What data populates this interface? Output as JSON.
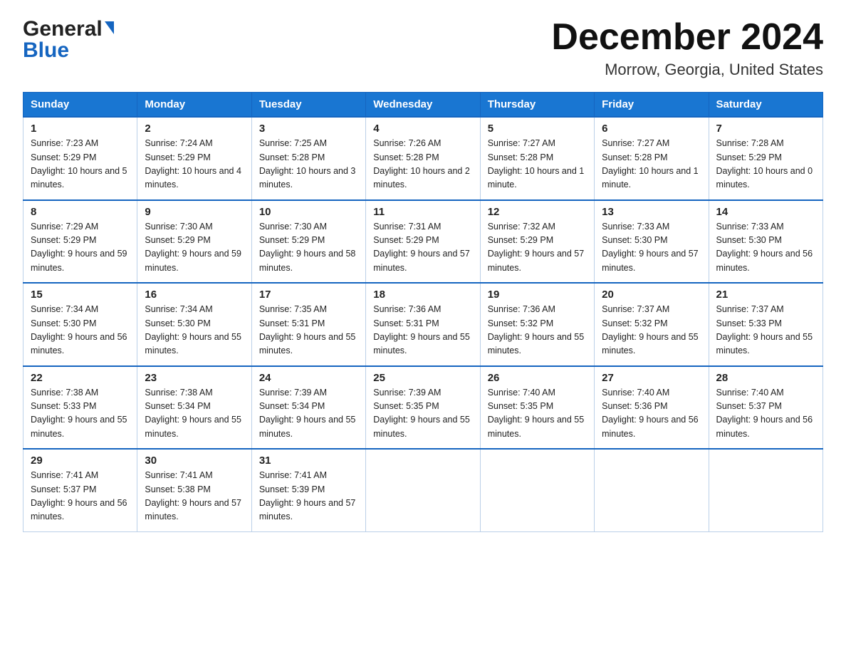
{
  "header": {
    "logo_general": "General",
    "logo_blue": "Blue",
    "month_title": "December 2024",
    "location": "Morrow, Georgia, United States"
  },
  "weekdays": [
    "Sunday",
    "Monday",
    "Tuesday",
    "Wednesday",
    "Thursday",
    "Friday",
    "Saturday"
  ],
  "weeks": [
    [
      {
        "day": "1",
        "sunrise": "7:23 AM",
        "sunset": "5:29 PM",
        "daylight": "10 hours and 5 minutes."
      },
      {
        "day": "2",
        "sunrise": "7:24 AM",
        "sunset": "5:29 PM",
        "daylight": "10 hours and 4 minutes."
      },
      {
        "day": "3",
        "sunrise": "7:25 AM",
        "sunset": "5:28 PM",
        "daylight": "10 hours and 3 minutes."
      },
      {
        "day": "4",
        "sunrise": "7:26 AM",
        "sunset": "5:28 PM",
        "daylight": "10 hours and 2 minutes."
      },
      {
        "day": "5",
        "sunrise": "7:27 AM",
        "sunset": "5:28 PM",
        "daylight": "10 hours and 1 minute."
      },
      {
        "day": "6",
        "sunrise": "7:27 AM",
        "sunset": "5:28 PM",
        "daylight": "10 hours and 1 minute."
      },
      {
        "day": "7",
        "sunrise": "7:28 AM",
        "sunset": "5:29 PM",
        "daylight": "10 hours and 0 minutes."
      }
    ],
    [
      {
        "day": "8",
        "sunrise": "7:29 AM",
        "sunset": "5:29 PM",
        "daylight": "9 hours and 59 minutes."
      },
      {
        "day": "9",
        "sunrise": "7:30 AM",
        "sunset": "5:29 PM",
        "daylight": "9 hours and 59 minutes."
      },
      {
        "day": "10",
        "sunrise": "7:30 AM",
        "sunset": "5:29 PM",
        "daylight": "9 hours and 58 minutes."
      },
      {
        "day": "11",
        "sunrise": "7:31 AM",
        "sunset": "5:29 PM",
        "daylight": "9 hours and 57 minutes."
      },
      {
        "day": "12",
        "sunrise": "7:32 AM",
        "sunset": "5:29 PM",
        "daylight": "9 hours and 57 minutes."
      },
      {
        "day": "13",
        "sunrise": "7:33 AM",
        "sunset": "5:30 PM",
        "daylight": "9 hours and 57 minutes."
      },
      {
        "day": "14",
        "sunrise": "7:33 AM",
        "sunset": "5:30 PM",
        "daylight": "9 hours and 56 minutes."
      }
    ],
    [
      {
        "day": "15",
        "sunrise": "7:34 AM",
        "sunset": "5:30 PM",
        "daylight": "9 hours and 56 minutes."
      },
      {
        "day": "16",
        "sunrise": "7:34 AM",
        "sunset": "5:30 PM",
        "daylight": "9 hours and 55 minutes."
      },
      {
        "day": "17",
        "sunrise": "7:35 AM",
        "sunset": "5:31 PM",
        "daylight": "9 hours and 55 minutes."
      },
      {
        "day": "18",
        "sunrise": "7:36 AM",
        "sunset": "5:31 PM",
        "daylight": "9 hours and 55 minutes."
      },
      {
        "day": "19",
        "sunrise": "7:36 AM",
        "sunset": "5:32 PM",
        "daylight": "9 hours and 55 minutes."
      },
      {
        "day": "20",
        "sunrise": "7:37 AM",
        "sunset": "5:32 PM",
        "daylight": "9 hours and 55 minutes."
      },
      {
        "day": "21",
        "sunrise": "7:37 AM",
        "sunset": "5:33 PM",
        "daylight": "9 hours and 55 minutes."
      }
    ],
    [
      {
        "day": "22",
        "sunrise": "7:38 AM",
        "sunset": "5:33 PM",
        "daylight": "9 hours and 55 minutes."
      },
      {
        "day": "23",
        "sunrise": "7:38 AM",
        "sunset": "5:34 PM",
        "daylight": "9 hours and 55 minutes."
      },
      {
        "day": "24",
        "sunrise": "7:39 AM",
        "sunset": "5:34 PM",
        "daylight": "9 hours and 55 minutes."
      },
      {
        "day": "25",
        "sunrise": "7:39 AM",
        "sunset": "5:35 PM",
        "daylight": "9 hours and 55 minutes."
      },
      {
        "day": "26",
        "sunrise": "7:40 AM",
        "sunset": "5:35 PM",
        "daylight": "9 hours and 55 minutes."
      },
      {
        "day": "27",
        "sunrise": "7:40 AM",
        "sunset": "5:36 PM",
        "daylight": "9 hours and 56 minutes."
      },
      {
        "day": "28",
        "sunrise": "7:40 AM",
        "sunset": "5:37 PM",
        "daylight": "9 hours and 56 minutes."
      }
    ],
    [
      {
        "day": "29",
        "sunrise": "7:41 AM",
        "sunset": "5:37 PM",
        "daylight": "9 hours and 56 minutes."
      },
      {
        "day": "30",
        "sunrise": "7:41 AM",
        "sunset": "5:38 PM",
        "daylight": "9 hours and 57 minutes."
      },
      {
        "day": "31",
        "sunrise": "7:41 AM",
        "sunset": "5:39 PM",
        "daylight": "9 hours and 57 minutes."
      },
      null,
      null,
      null,
      null
    ]
  ]
}
